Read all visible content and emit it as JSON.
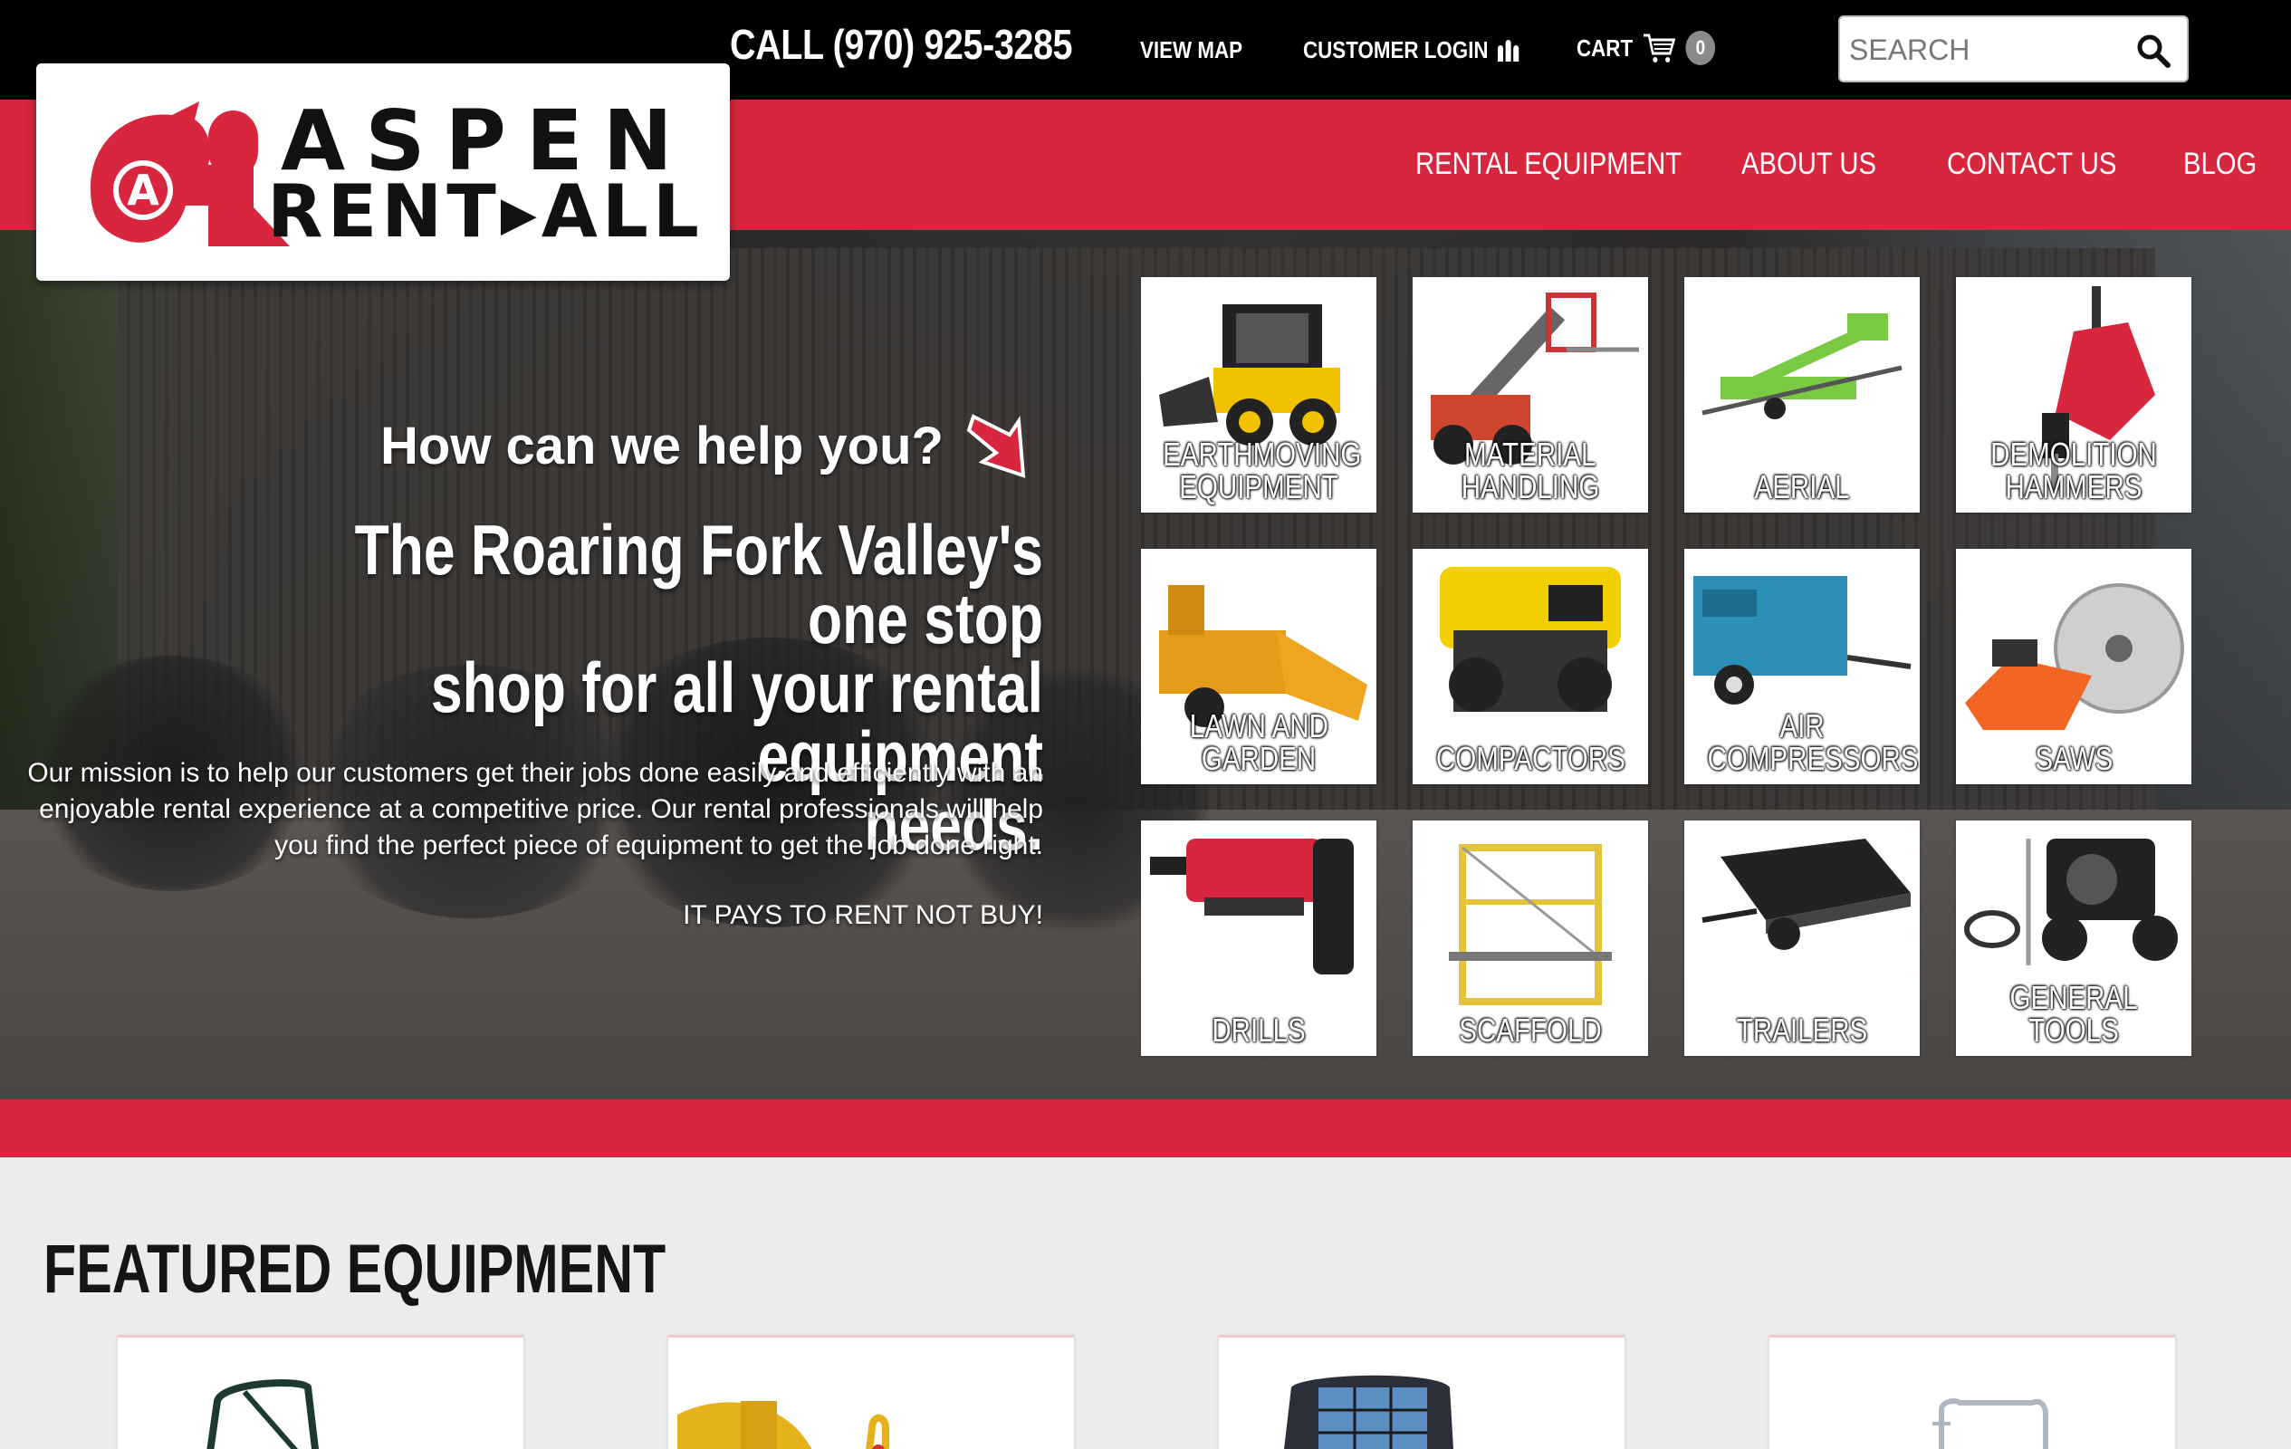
{
  "topbar": {
    "phone": "CALL (970) 925-3285",
    "view_map": "VIEW MAP",
    "customer_login": "CUSTOMER LOGIN",
    "cart": "CART",
    "cart_count": "0",
    "search_placeholder": "SEARCH"
  },
  "logo": {
    "line1": "ASPEN",
    "line2": "RENT▸ALL",
    "mark_letter": "A"
  },
  "nav": {
    "items": [
      "RENTAL EQUIPMENT",
      "ABOUT US",
      "CONTACT US",
      "BLOG"
    ]
  },
  "hero": {
    "help": "How can we help you?",
    "headline_1": "The Roaring Fork Valley's one stop",
    "headline_2": "shop for all your rental equipment",
    "headline_3": "needs.",
    "mission": "Our mission is to help our customers get their jobs done easily and efficiently with an enjoyable rental experience at a competitive price. Our rental professionals will help you find the perfect piece of equipment to get the job done right.",
    "slogan": "IT PAYS TO RENT NOT BUY!"
  },
  "categories": [
    {
      "l1": "EARTHMOVING",
      "l2": "EQUIPMENT"
    },
    {
      "l1": "MATERIAL",
      "l2": "HANDLING"
    },
    {
      "l1": "",
      "l2": "AERIAL"
    },
    {
      "l1": "DEMOLITION",
      "l2": "HAMMERS"
    },
    {
      "l1": "LAWN AND",
      "l2": "GARDEN"
    },
    {
      "l1": "",
      "l2": "COMPACTORS"
    },
    {
      "l1": "AIR",
      "l2": "COMPRESSORS"
    },
    {
      "l1": "",
      "l2": "SAWS"
    },
    {
      "l1": "",
      "l2": "DRILLS"
    },
    {
      "l1": "",
      "l2": "SCAFFOLD"
    },
    {
      "l1": "",
      "l2": "TRAILERS"
    },
    {
      "l1": "",
      "l2": "GENERAL TOOLS"
    }
  ],
  "featured": {
    "title": "FEATURED EQUIPMENT"
  },
  "colors": {
    "brand_red": "#d7263d",
    "topbar": "#000000",
    "page_bg": "#ececec"
  },
  "icons": [
    "people-icon",
    "cart-icon",
    "search-icon",
    "red-arrow-icon"
  ]
}
